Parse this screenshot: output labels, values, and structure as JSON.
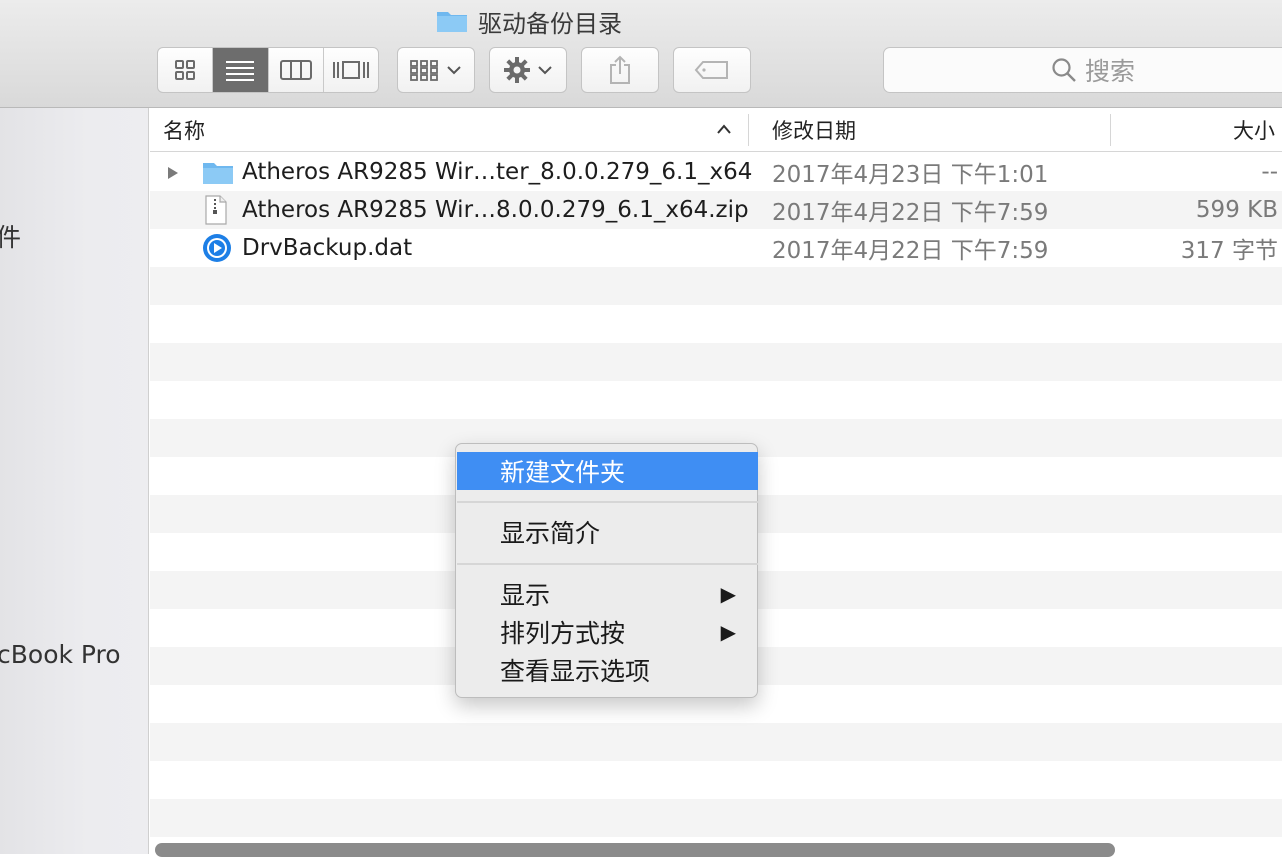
{
  "window": {
    "title": "驱动备份目录",
    "title_icon": "folder-icon"
  },
  "toolbar": {
    "view_buttons": [
      "icon-view",
      "list-view",
      "column-view",
      "cover-flow-view"
    ],
    "active_view": "list-view",
    "arrange_icon": "grid-arrange-icon",
    "action_icon": "gear-icon",
    "share_icon": "share-icon",
    "tag_icon": "tag-icon",
    "search_placeholder": "搜索"
  },
  "sidebar": {
    "items": [
      {
        "label": "件"
      },
      {
        "label": "cBook Pro"
      }
    ]
  },
  "columns": {
    "name": "名称",
    "date": "修改日期",
    "size": "大小"
  },
  "files": [
    {
      "name": "Atheros AR9285 Wir…ter_8.0.0.279_6.1_x64",
      "date": "2017年4月23日 下午1:01",
      "size": "--",
      "kind": "folder"
    },
    {
      "name": "Atheros AR9285 Wir…8.0.0.279_6.1_x64.zip",
      "date": "2017年4月22日 下午7:59",
      "size": "599 KB",
      "kind": "zip"
    },
    {
      "name": "DrvBackup.dat",
      "date": "2017年4月22日 下午7:59",
      "size": "317 字节",
      "kind": "dat"
    }
  ],
  "context_menu": {
    "items": [
      {
        "label": "新建文件夹",
        "highlighted": true
      },
      {
        "label": "显示简介"
      },
      {
        "label": "显示",
        "arrow": "▶"
      },
      {
        "label": "排列方式按",
        "arrow": "▶"
      },
      {
        "label": "查看显示选项"
      }
    ]
  },
  "colors": {
    "accent": "#3f8ef3",
    "folder": "#6fb8ef"
  }
}
